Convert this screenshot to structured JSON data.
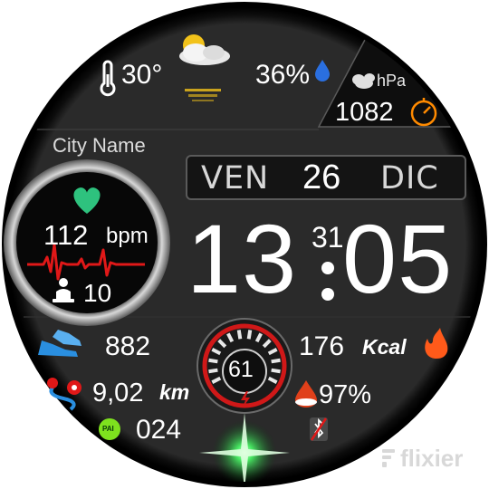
{
  "weather": {
    "temperature": "30°",
    "humidity": "36%",
    "condition_icon": "partly-cloudy-night-icon"
  },
  "pressure": {
    "unit_icon_label": "hPa",
    "value": "1082"
  },
  "location": {
    "city": "City Name"
  },
  "date": {
    "weekday": "VEN",
    "day": "26",
    "month": "DIC"
  },
  "time": {
    "hours": "13",
    "minutes": "05",
    "seconds": "31"
  },
  "heart": {
    "bpm_value": "112",
    "bpm_unit": "bpm",
    "stand_count": "10"
  },
  "stats": {
    "steps": "882",
    "distance_value": "9,02",
    "distance_unit": "km",
    "pai_badge": "PAI",
    "pai_value": "024",
    "calories_value": "176",
    "calories_unit": "Kcal",
    "battery_percent": "97%",
    "battery_gauge_value": "61"
  },
  "watermark": {
    "brand": "flixier"
  },
  "colors": {
    "accent_red": "#d01818",
    "heart_green": "#2ec27e",
    "humidity_blue": "#2a6fe0",
    "steps_blue": "#2a8fe0",
    "pai_green": "#7ee21e",
    "flame_orange": "#ff5a1a",
    "compass_orange": "#ff8a00"
  }
}
